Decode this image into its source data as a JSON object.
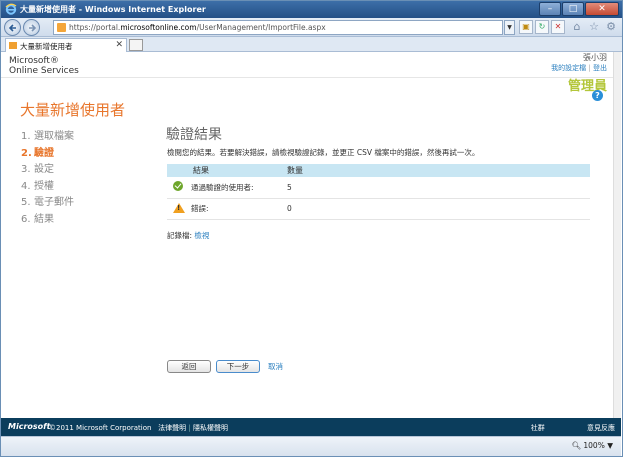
{
  "window": {
    "title": "大量新增使用者 - Windows Internet Explorer"
  },
  "browser": {
    "url_prefix": "https://portal.",
    "url_domain": "microsoftonline.com",
    "url_path": "/UserManagement/ImportFile.aspx",
    "tab_label": "大量新增使用者",
    "zoom": "100%"
  },
  "header": {
    "brand_line1": "Microsoft®",
    "brand_line2": "Online Services",
    "user_name": "張小羽",
    "my_profile": "我的設定檔",
    "sign_out": "登出",
    "role": "管理員",
    "help": "?"
  },
  "wizard": {
    "title": "大量新增使用者",
    "steps": [
      {
        "num": "1.",
        "label": "選取檔案"
      },
      {
        "num": "2.",
        "label": "驗證"
      },
      {
        "num": "3.",
        "label": "設定"
      },
      {
        "num": "4.",
        "label": "授權"
      },
      {
        "num": "5.",
        "label": "電子郵件"
      },
      {
        "num": "6.",
        "label": "結果"
      }
    ]
  },
  "main": {
    "title": "驗證結果",
    "description": "檢閱您的結果。若要解決錯誤，請檢視驗證記錄，並更正 CSV 檔案中的錯誤，然後再試一次。",
    "table": {
      "col_result": "結果",
      "col_count": "數量",
      "rows": [
        {
          "label": "通過驗證的使用者:",
          "count": "5"
        },
        {
          "label": "錯誤:",
          "count": "0"
        }
      ]
    },
    "log_label": "記錄檔:",
    "log_link": "檢視",
    "back_button": "返回",
    "next_button": "下一步",
    "cancel_link": "取消"
  },
  "footer": {
    "logo": "Microsoft",
    "copyright": "©2011 Microsoft Corporation",
    "legal": "法律聲明",
    "privacy": "隱私權聲明",
    "community": "社群",
    "feedback": "意見反應"
  }
}
